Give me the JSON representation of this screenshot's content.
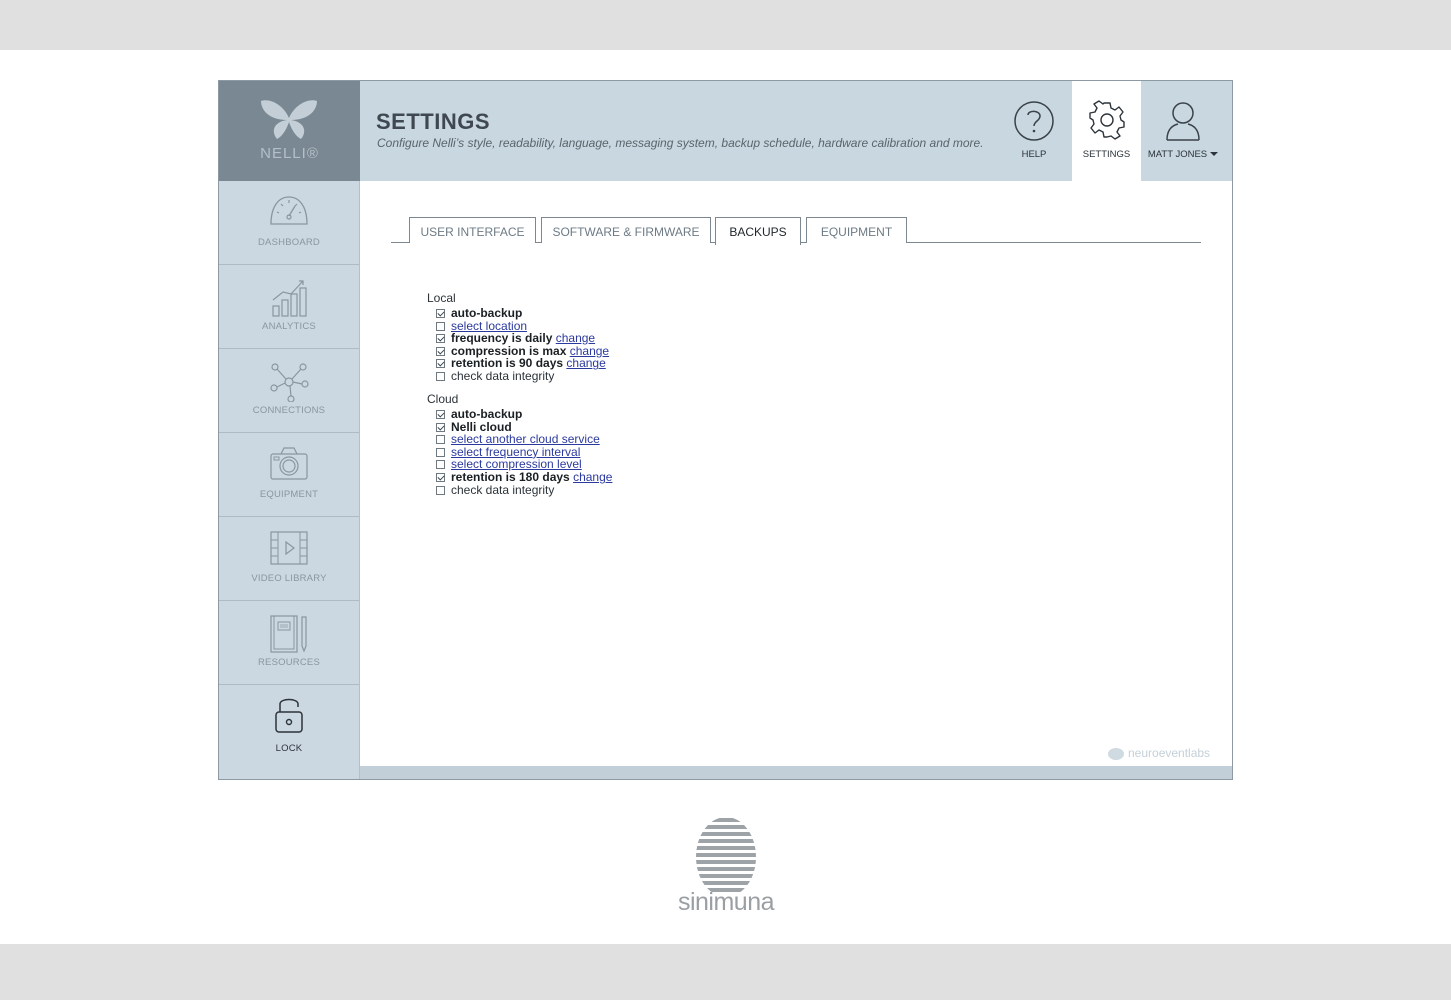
{
  "app": {
    "logo": "NELLI®",
    "title": "SETTINGS",
    "subtitle": "Configure Nelli’s style, readability, language, messaging system, backup schedule, hardware calibration and more."
  },
  "header": {
    "help_label": "HELP",
    "settings_label": "SETTINGS",
    "user_label": "MATT JONES"
  },
  "sidebar": {
    "items": [
      {
        "label": "DASHBOARD",
        "icon": "gauge-icon"
      },
      {
        "label": "ANALYTICS",
        "icon": "bar-chart-icon"
      },
      {
        "label": "CONNECTIONS",
        "icon": "network-icon"
      },
      {
        "label": "EQUIPMENT",
        "icon": "camera-icon"
      },
      {
        "label": "VIDEO LIBRARY",
        "icon": "video-icon"
      },
      {
        "label": "RESOURCES",
        "icon": "notebook-icon"
      },
      {
        "label": "LOCK",
        "icon": "lock-icon"
      }
    ]
  },
  "tabs": [
    {
      "label": "USER INTERFACE",
      "active": false
    },
    {
      "label": "SOFTWARE & FIRMWARE",
      "active": false
    },
    {
      "label": "BACKUPS",
      "active": true
    },
    {
      "label": "EQUIPMENT",
      "active": false
    }
  ],
  "local": {
    "title": "Local",
    "options": [
      {
        "checked": true,
        "text": "auto-backup",
        "link": ""
      },
      {
        "checked": false,
        "text": "",
        "link": "select location"
      },
      {
        "checked": true,
        "text": "frequency is daily",
        "link": "change"
      },
      {
        "checked": true,
        "text": "compression is max",
        "link": "change"
      },
      {
        "checked": true,
        "text": "retention is 90 days",
        "link": "change"
      },
      {
        "checked": false,
        "text": "check data integrity",
        "link": ""
      }
    ]
  },
  "cloud": {
    "title": "Cloud",
    "options": [
      {
        "checked": true,
        "text": "auto-backup",
        "link": ""
      },
      {
        "checked": true,
        "text": "Nelli cloud",
        "link": ""
      },
      {
        "checked": false,
        "text": "",
        "link": "select another cloud service"
      },
      {
        "checked": false,
        "text": "",
        "link": "select frequency interval"
      },
      {
        "checked": false,
        "text": "",
        "link": "select compression level"
      },
      {
        "checked": true,
        "text": "retention is 180 days",
        "link": "change"
      },
      {
        "checked": false,
        "text": "check data integrity",
        "link": ""
      }
    ]
  },
  "brand": "neuroeventlabs",
  "company": "sinimuna",
  "colors": {
    "header_bg": "#c9d7e0",
    "logo_bg": "#7a8893",
    "sidebar_bg": "#cbd8e1",
    "link": "#2b3a9e"
  }
}
